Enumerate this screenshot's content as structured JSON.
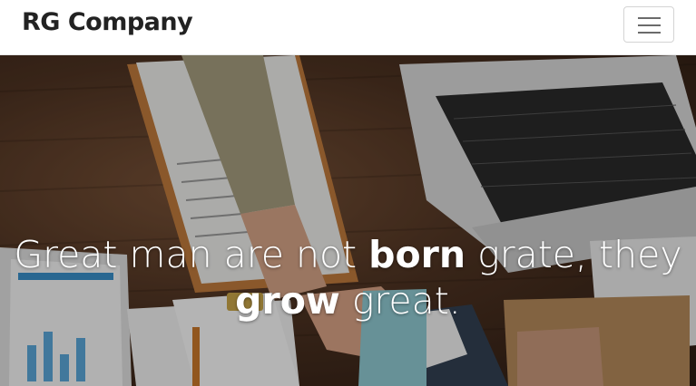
{
  "navbar": {
    "brand": "RG Company",
    "menu_icon": "hamburger-icon"
  },
  "hero": {
    "headline_line1_pre": "Great man are not ",
    "headline_line1_bold": "born",
    "headline_line1_post": " grate, they",
    "headline_line2_bold": "grow",
    "headline_line2_post": " great.",
    "background_image": "office desk handshake photo"
  },
  "colors": {
    "navbar_bg": "#ffffff",
    "brand_text": "#222222",
    "headline_text": "#ffffff"
  }
}
